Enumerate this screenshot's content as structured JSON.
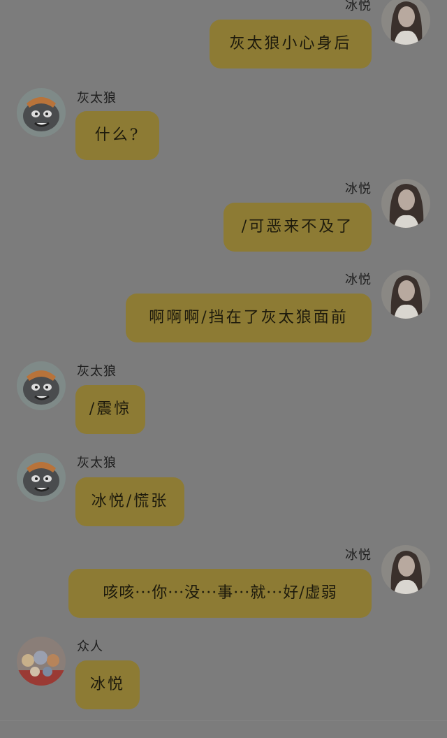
{
  "colors": {
    "background": "#7c7c7c",
    "bubble": "#8d7b34",
    "text": "#1d1a0c"
  },
  "messages": [
    {
      "side": "right",
      "sender": "冰悦",
      "avatar": "avatar-bingyue",
      "text": "灰太狼小心身后"
    },
    {
      "side": "left",
      "sender": "灰太狼",
      "avatar": "avatar-huitailang",
      "text": "什么?"
    },
    {
      "side": "right",
      "sender": "冰悦",
      "avatar": "avatar-bingyue",
      "text": "/可恶来不及了"
    },
    {
      "side": "right",
      "sender": "冰悦",
      "avatar": "avatar-bingyue",
      "text": "啊啊啊/挡在了灰太狼面前"
    },
    {
      "side": "left",
      "sender": "灰太狼",
      "avatar": "avatar-huitailang",
      "text": "/震惊"
    },
    {
      "side": "left",
      "sender": "灰太狼",
      "avatar": "avatar-huitailang",
      "text": "冰悦/慌张"
    },
    {
      "side": "right",
      "sender": "冰悦",
      "avatar": "avatar-bingyue",
      "text": "咳咳···你···没···事···就···好/虚弱"
    },
    {
      "side": "left",
      "sender": "众人",
      "avatar": "avatar-group",
      "text": "冰悦"
    }
  ]
}
